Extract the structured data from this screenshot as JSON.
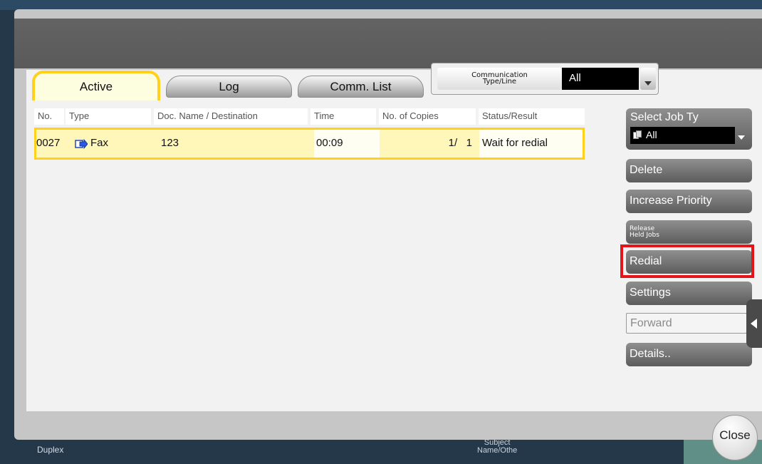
{
  "background": {
    "duplex_label": "Duplex",
    "subject_label_1": "Subject",
    "subject_label_2": "Name/Othe"
  },
  "tabs": [
    {
      "label": "Active",
      "selected": true
    },
    {
      "label": "Log",
      "selected": false
    },
    {
      "label": "Comm. List",
      "selected": false
    }
  ],
  "comm_filter": {
    "label_line1": "Communication",
    "label_line2": "Type/Line",
    "value": "All"
  },
  "table": {
    "headers": [
      "No.",
      "Type",
      "Doc. Name / Destination",
      "Time",
      "No. of Copies",
      "Status/Result"
    ],
    "rows": [
      {
        "no": "0027",
        "type": "Fax",
        "icon": "fax-send-icon",
        "destination": "123",
        "time": "00:09",
        "copies": "1/   1",
        "status": "Wait for redial",
        "selected": true
      }
    ]
  },
  "job_type": {
    "label": "Select Job Ty",
    "value": "All",
    "icon": "copy-pages-icon"
  },
  "actions": {
    "delete": "Delete",
    "increase_priority": "Increase Priority",
    "release_line1": "Release",
    "release_line2": "Held Jobs",
    "redial": "Redial",
    "settings": "Settings",
    "forward": "Forward",
    "details": "Details.."
  },
  "close_label": "Close",
  "colors": {
    "accent_yellow": "#ffd11a",
    "highlight_red": "#e3141a"
  }
}
